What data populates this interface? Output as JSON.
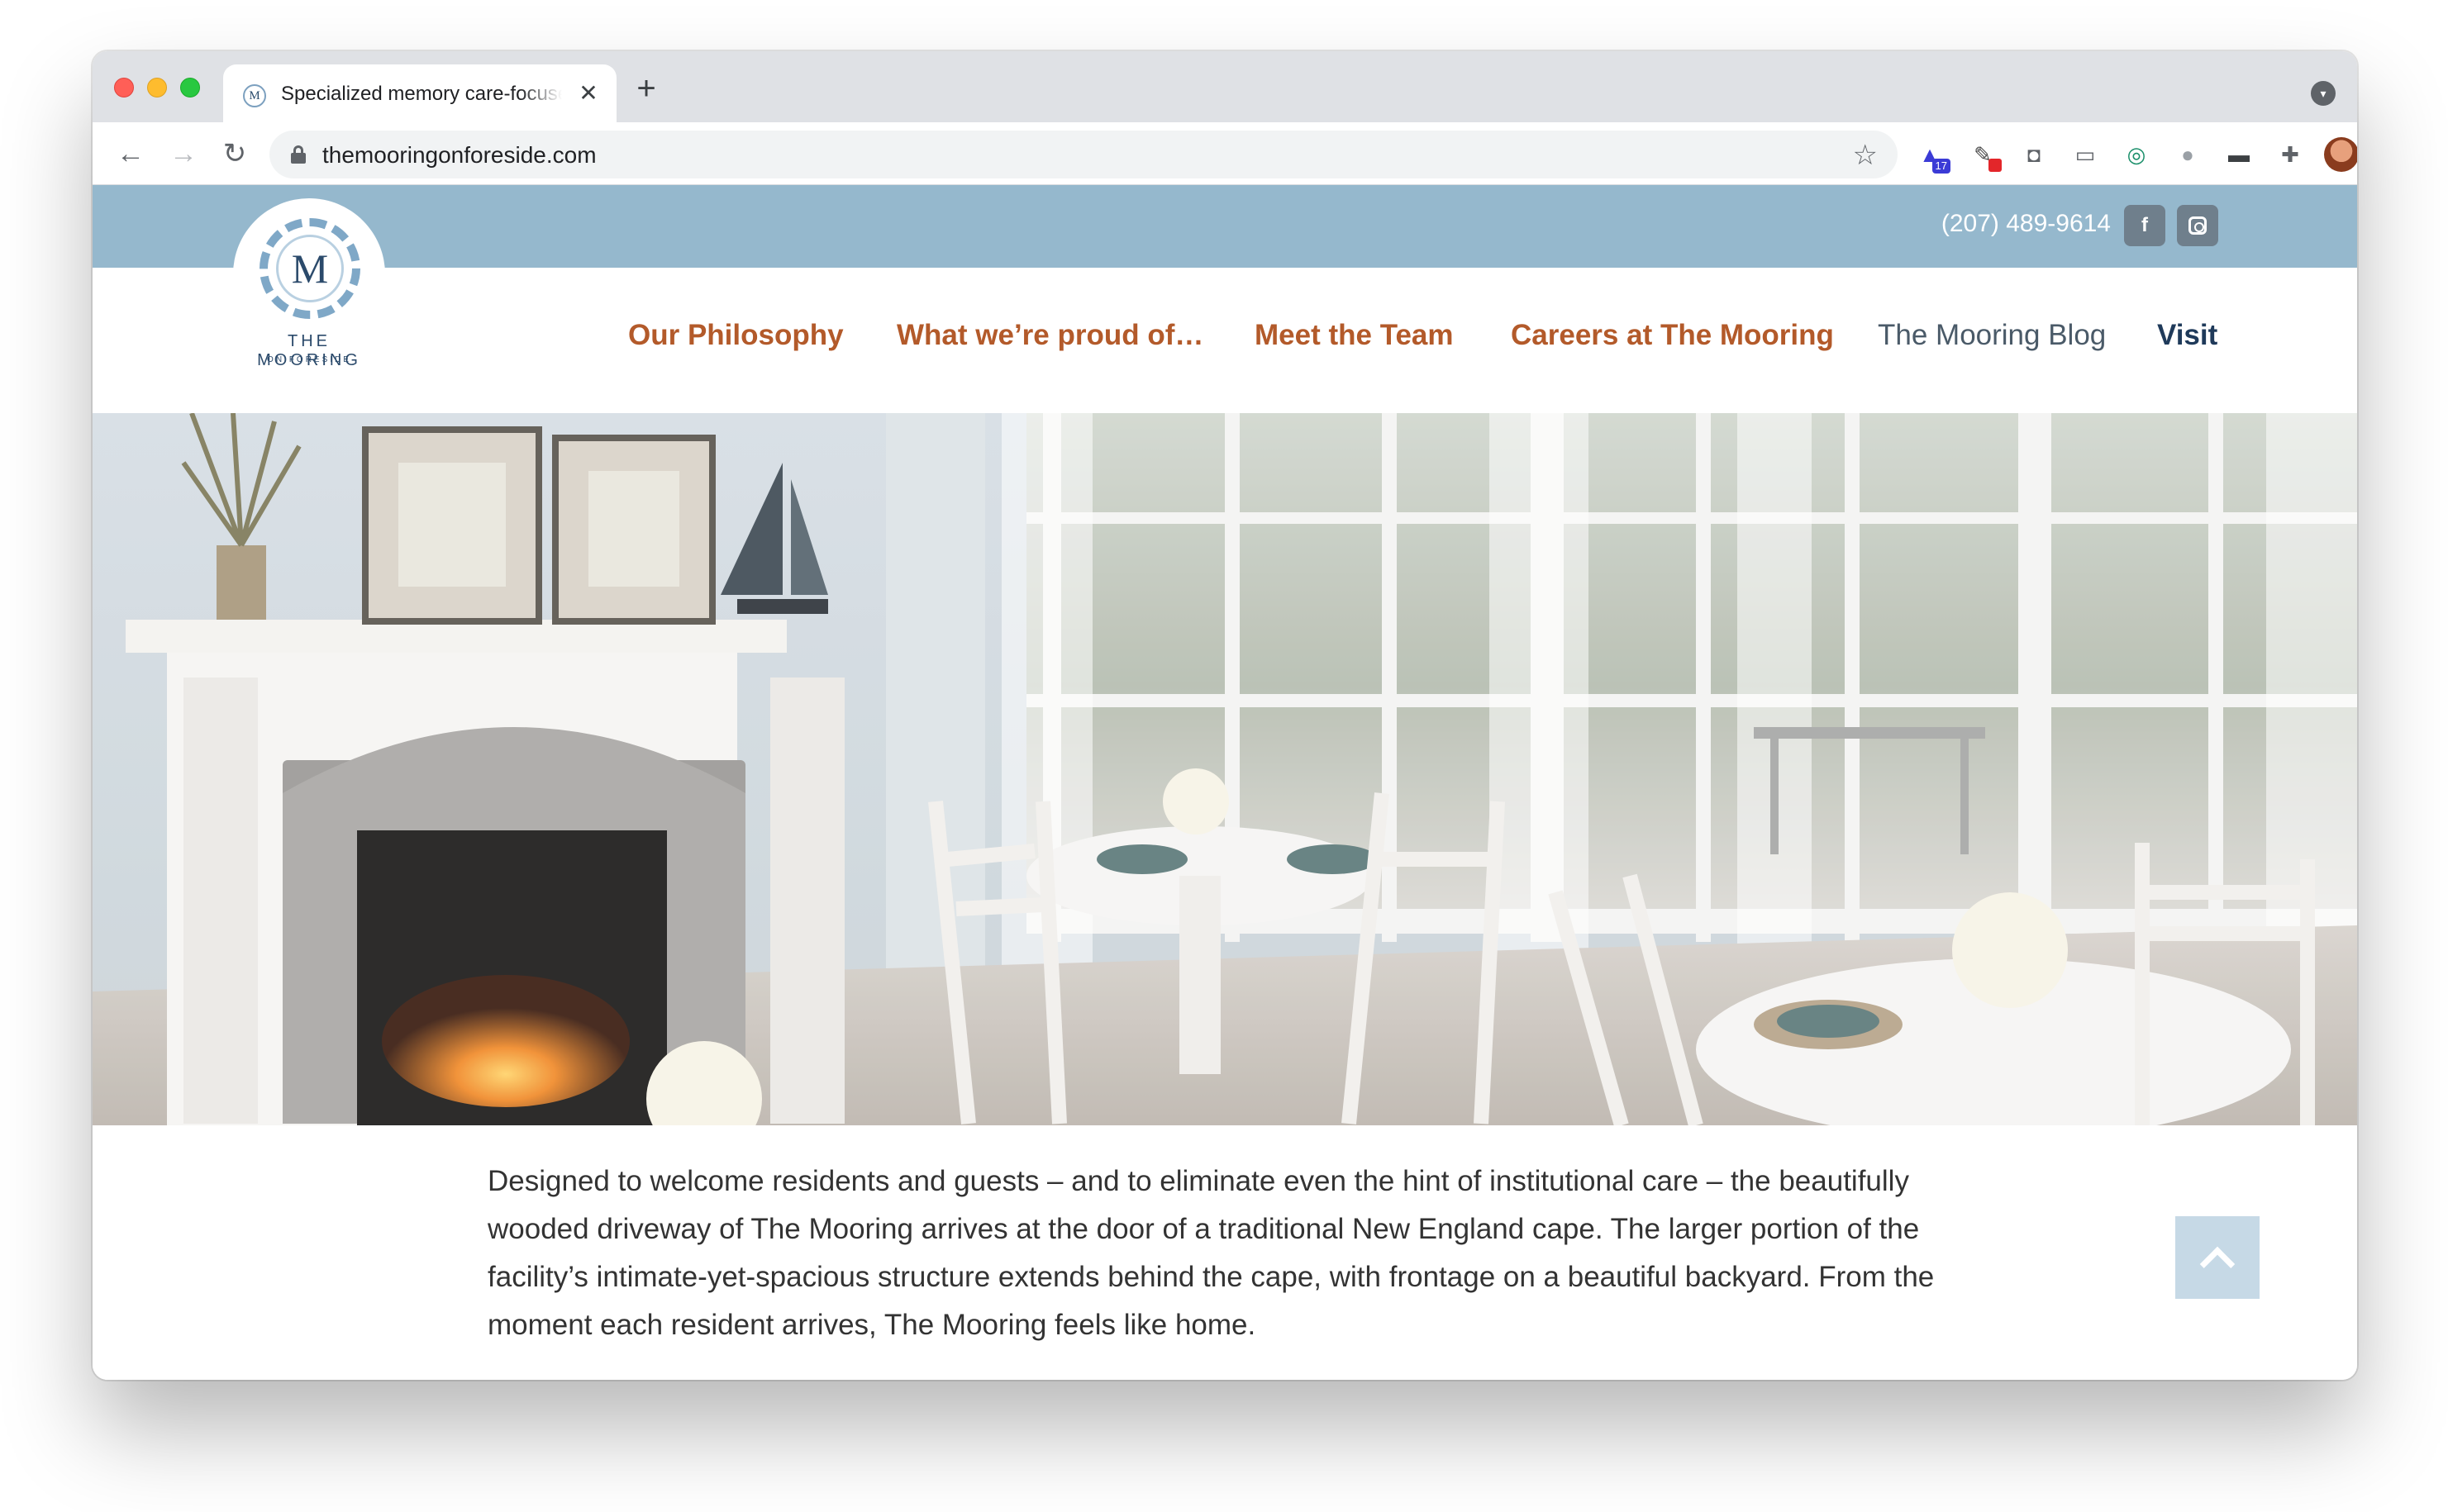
{
  "browser": {
    "tab_title": "Specialized memory care-focused",
    "tab_favicon": "M",
    "url": "themooringonforeside.com",
    "extension_badge": "17"
  },
  "site": {
    "phone": "(207) 489-9614",
    "logo": {
      "letter": "M",
      "name": "THE MOORING",
      "sub": "ON FORESIDE"
    },
    "nav": [
      {
        "label": "Our Philosophy"
      },
      {
        "label": "What we’re proud of…"
      },
      {
        "label": "Meet the Team"
      },
      {
        "label": "Careers at The Mooring"
      },
      {
        "label": "The Mooring Blog"
      },
      {
        "label": "Visit"
      }
    ],
    "intro_text": "Designed to welcome residents and guests – and to eliminate even the hint of institutional care – the beautifully wooded driveway of The Mooring arrives at the door of a traditional New England cape. The larger portion of the facility’s intimate-yet-spacious structure extends behind the cape, with frontage on a beautiful backyard. From the moment each resident arrives, The Mooring feels like home."
  },
  "colors": {
    "topbar": "#95b8cd",
    "nav_orange": "#b35a2a",
    "nav_blog": "#4a5a68",
    "nav_visit": "#1f3a5a",
    "logo_blue": "#2b4a6b"
  },
  "icons": [
    "back-arrow-icon",
    "forward-arrow-icon",
    "reload-icon",
    "lock-icon",
    "star-icon",
    "extensions-icon",
    "facebook-icon",
    "instagram-icon",
    "chevron-up-icon"
  ]
}
